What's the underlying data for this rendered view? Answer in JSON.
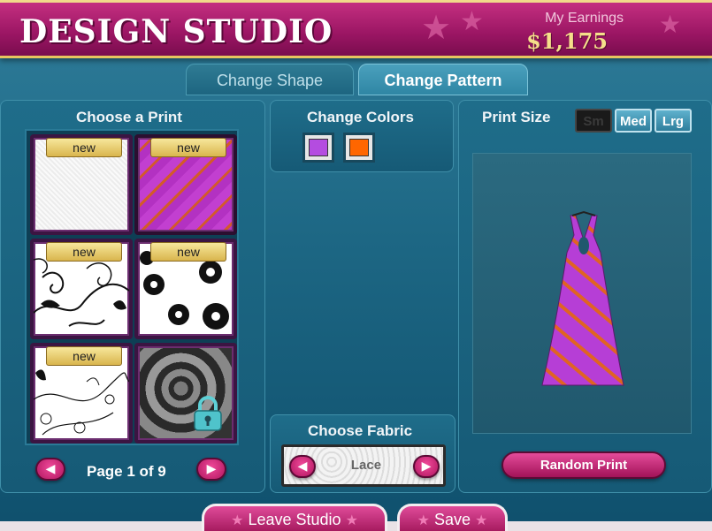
{
  "header": {
    "title": "DESIGN STUDIO",
    "earnings_label": "My Earnings",
    "earnings_value": "$1,175"
  },
  "tabs": [
    {
      "label": "Change Shape",
      "active": false
    },
    {
      "label": "Change Pattern",
      "active": true
    }
  ],
  "print_panel": {
    "title": "Choose a Print",
    "tiles": [
      {
        "badge": "new",
        "pattern": "white-linen",
        "locked": false,
        "selected": false
      },
      {
        "badge": "new",
        "pattern": "purple-orange-stripes",
        "locked": false,
        "selected": true
      },
      {
        "badge": "new",
        "pattern": "black-swirls",
        "locked": false,
        "selected": false
      },
      {
        "badge": "new",
        "pattern": "black-flowers",
        "locked": false,
        "selected": false
      },
      {
        "badge": "new",
        "pattern": "floral-vines",
        "locked": false,
        "selected": false
      },
      {
        "badge": "",
        "pattern": "grey-circles",
        "locked": true,
        "selected": false
      }
    ],
    "pager_text": "Page 1 of 9"
  },
  "colors_panel": {
    "title": "Change Colors",
    "swatches": [
      "#b44ce0",
      "#ff6600"
    ]
  },
  "size_panel": {
    "title": "Print Size",
    "options": [
      "Sm",
      "Med",
      "Lrg"
    ],
    "disabled_option": "Sm"
  },
  "random_button": "Random Print",
  "fabric_panel": {
    "title": "Choose Fabric",
    "current": "Lace"
  },
  "footer": {
    "leave_label": "Leave Studio",
    "save_label": "Save"
  },
  "colors": {
    "accent": "#a01659",
    "gold": "#f5df8a"
  }
}
